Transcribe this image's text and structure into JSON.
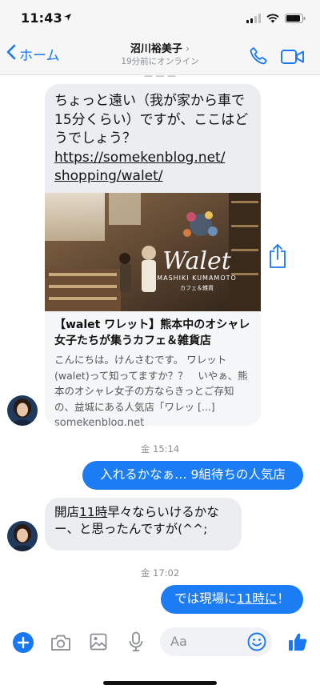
{
  "status_bar": {
    "time": "11:43"
  },
  "header": {
    "back_label": "ホーム",
    "contact_name": "沼川裕美子",
    "contact_status": "19分前にオンライン"
  },
  "messages": {
    "link_message": {
      "text": "ちょっと遠い（我が家から車で15分くらい）ですが、ここはどうでしょう？",
      "url_line1": "https://somekenblog.net/",
      "url_line2": "shopping/walet/",
      "preview_image_logo": "Walet",
      "preview_image_caption": "MASHIKI KUMAMOTO",
      "preview_image_tag": "カフェ＆雑貨",
      "preview_title": "【walet ワレット】熊本中のオシャレ女子たちが集うカフェ＆雑貨店",
      "preview_description": "こんにちは。けんさむです。 ワレット(walet)って知ってますか？？　いやぁ、熊本のオシャレ女子の方ならきっとご存知の、益城にある人気店「ワレッ [...]",
      "preview_domain": "somekenblog.net"
    },
    "timestamp_1": "金 15:14",
    "outgoing_1": "入れるかなぁ… 9組待ちの人気店",
    "incoming_2_part1": "開店",
    "incoming_2_link": "11時",
    "incoming_2_part2": "早々ならいけるかなー、と思ったんですが(^^;",
    "timestamp_2": "金 17:02",
    "outgoing_2_part1": "では現場に",
    "outgoing_2_link": "11時に",
    "outgoing_2_part2": "！"
  },
  "composer": {
    "placeholder": "Aa"
  },
  "colors": {
    "accent": "#1877f2",
    "outgoing_bubble": "#1c7cf4",
    "incoming_bubble": "#ebedf0"
  },
  "icons": [
    "location-arrow-icon",
    "signal-icon",
    "wifi-icon",
    "battery-icon",
    "chevron-left-icon",
    "chevron-right-icon",
    "phone-icon",
    "video-icon",
    "share-icon",
    "plus-icon",
    "camera-icon",
    "gallery-icon",
    "microphone-icon",
    "emoji-icon",
    "thumbs-up-icon"
  ]
}
